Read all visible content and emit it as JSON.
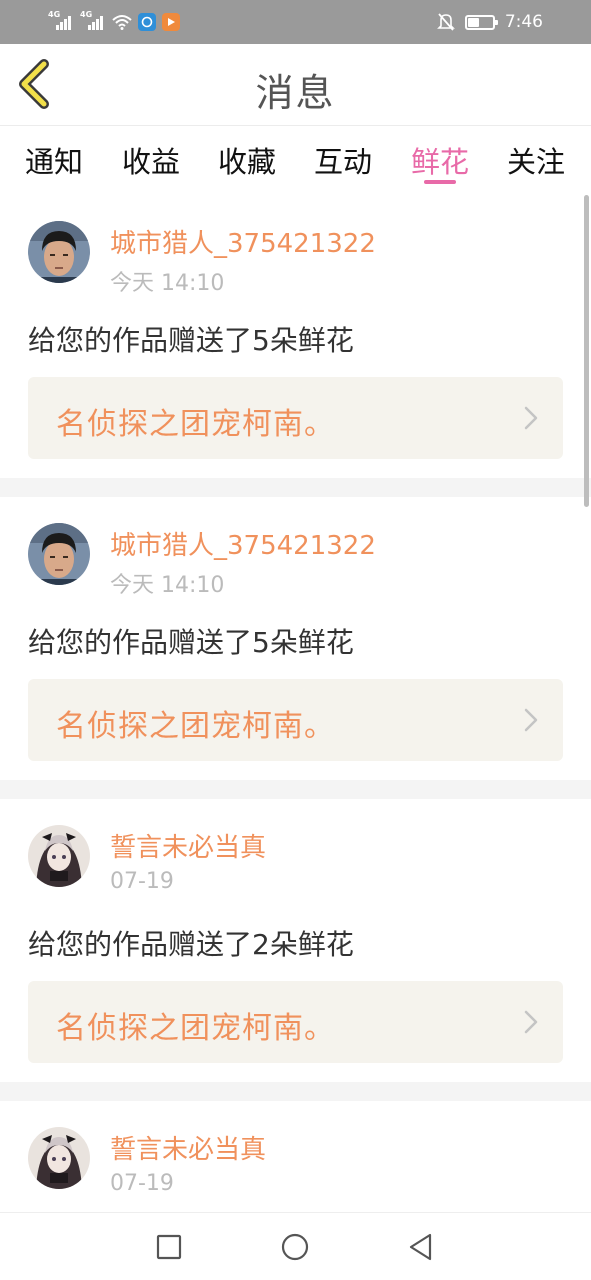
{
  "status_bar": {
    "network1": "4G",
    "network2": "4G",
    "time": "7:46",
    "battery_level": 0.45,
    "icons": [
      "signal-icon",
      "signal-icon",
      "wifi-icon",
      "app-notification-icon",
      "play-notification-icon",
      "mute-bell-icon",
      "battery-icon"
    ]
  },
  "header": {
    "title": "消息",
    "back_icon": "chevron-left-icon"
  },
  "tabs": [
    {
      "label": "通知",
      "active": false
    },
    {
      "label": "收益",
      "active": false
    },
    {
      "label": "收藏",
      "active": false
    },
    {
      "label": "互动",
      "active": false
    },
    {
      "label": "鲜花",
      "active": true
    },
    {
      "label": "关注",
      "active": false
    }
  ],
  "messages": [
    {
      "username": "城市猎人_375421322",
      "time": "今天 14:10",
      "text": "给您的作品赠送了5朵鲜花",
      "work": "名侦探之团宠柯南。"
    },
    {
      "username": "城市猎人_375421322",
      "time": "今天 14:10",
      "text": "给您的作品赠送了5朵鲜花",
      "work": "名侦探之团宠柯南。"
    },
    {
      "username": "誓言未必当真",
      "time": "07-19",
      "text": "给您的作品赠送了2朵鲜花",
      "work": "名侦探之团宠柯南。"
    },
    {
      "username": "誓言未必当真",
      "time": "07-19"
    }
  ],
  "colors": {
    "accent_pink": "#e86aa8",
    "username_orange": "#f0915c",
    "work_bg": "#f5f3ed",
    "status_bar_bg": "#9a9a9a"
  },
  "nav_bar": {
    "icons": [
      "recent-apps-icon",
      "home-icon",
      "back-triangle-icon"
    ]
  }
}
